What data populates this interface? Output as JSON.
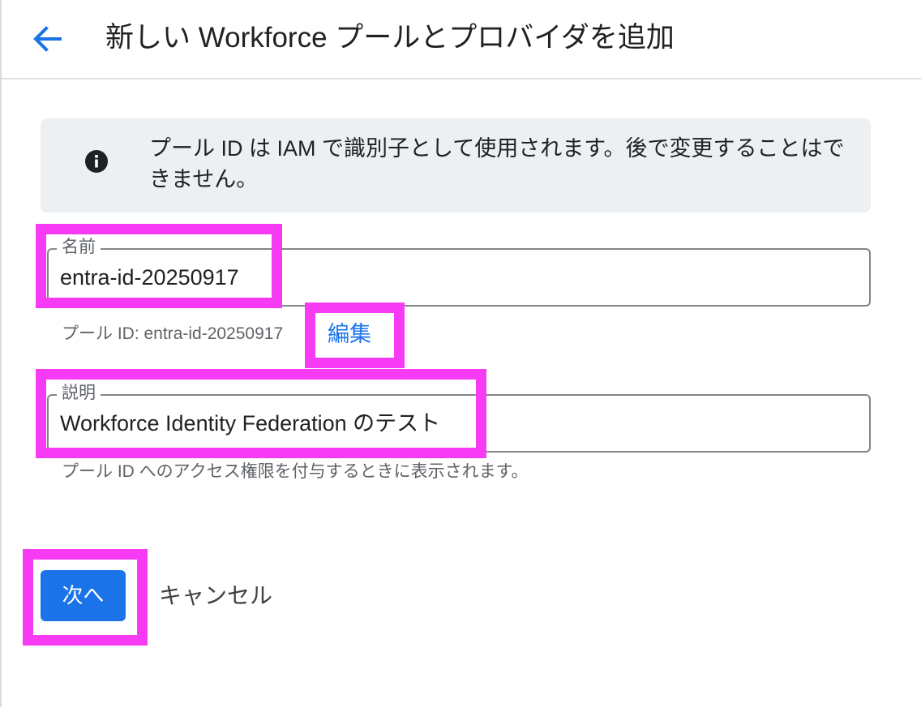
{
  "header": {
    "title": "新しい Workforce プールとプロバイダを追加",
    "back_icon": "arrow-back-icon"
  },
  "info_banner": {
    "icon": "info-icon",
    "text": "プール ID は IAM で識別子として使用されます。後で変更することはできません。"
  },
  "form": {
    "name": {
      "label": "名前",
      "value": "entra-id-20250917"
    },
    "pool_id_hint": "プール ID: entra-id-20250917",
    "edit_label": "編集",
    "description": {
      "label": "説明",
      "value": "Workforce Identity Federation のテスト"
    },
    "description_hint": "プール ID へのアクセス権限を付与するときに表示されます。"
  },
  "actions": {
    "next_label": "次へ",
    "cancel_label": "キャンセル"
  },
  "colors": {
    "accent": "#1a73e8",
    "highlight": "#f73af4",
    "banner_bg": "#edf0f2"
  }
}
